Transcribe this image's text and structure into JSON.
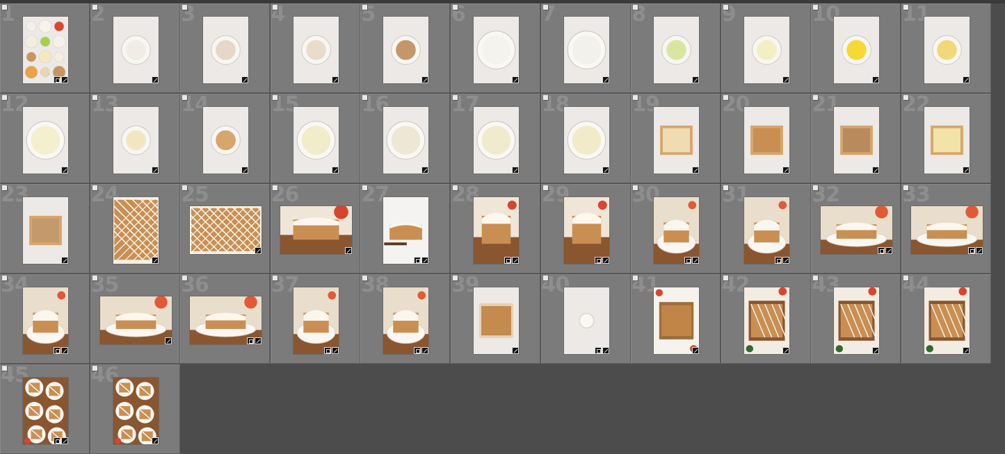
{
  "window": {
    "background": "#4c4c4c",
    "cell_color": "#7b7b7b"
  },
  "badges": {
    "edit_icon": "develop-adjust-icon",
    "collection_icon": "virtual-copy-icon"
  },
  "grid": {
    "cells": [
      {
        "n": "1",
        "o": "p",
        "s": "ing",
        "b": [
          "sq",
          "crop"
        ]
      },
      {
        "n": "2",
        "o": "p",
        "s": "bowl",
        "c": "#f2ede4",
        "b": [
          "crop"
        ]
      },
      {
        "n": "3",
        "o": "p",
        "s": "bowl",
        "c": "#e6d8c8",
        "b": [
          "crop"
        ]
      },
      {
        "n": "4",
        "o": "p",
        "s": "bowl",
        "c": "#e8dccb",
        "b": [
          "crop"
        ]
      },
      {
        "n": "5",
        "o": "p",
        "s": "bowl",
        "c": "#c4966a",
        "b": [
          "crop"
        ]
      },
      {
        "n": "6",
        "o": "p",
        "s": "bigbowl",
        "c": "#f5f3ee",
        "b": [
          "crop"
        ]
      },
      {
        "n": "7",
        "o": "p",
        "s": "bigbowl",
        "c": "#f3f1ec",
        "b": [
          "crop"
        ]
      },
      {
        "n": "8",
        "o": "p",
        "s": "bowl",
        "c": "#d9e6a0",
        "b": [
          "crop"
        ]
      },
      {
        "n": "9",
        "o": "p",
        "s": "bowl",
        "c": "#f4efc2",
        "b": [
          "crop"
        ]
      },
      {
        "n": "10",
        "o": "p",
        "s": "bowl",
        "c": "#f6d933",
        "b": [
          "crop"
        ]
      },
      {
        "n": "11",
        "o": "p",
        "s": "bowl",
        "c": "#f1d97a",
        "b": [
          "crop"
        ]
      },
      {
        "n": "12",
        "o": "p",
        "s": "bigbowl",
        "c": "#f4efcf",
        "b": [
          "crop"
        ]
      },
      {
        "n": "13",
        "o": "p",
        "s": "bowl",
        "c": "#f1e6c0",
        "b": [
          "crop"
        ]
      },
      {
        "n": "14",
        "o": "p",
        "s": "bowl",
        "c": "#d7a66b",
        "b": [
          "crop"
        ]
      },
      {
        "n": "15",
        "o": "p",
        "s": "bigbowl",
        "c": "#f1ecc9",
        "b": [
          "crop"
        ]
      },
      {
        "n": "16",
        "o": "p",
        "s": "bigbowl",
        "c": "#eee7d4",
        "b": [
          "crop"
        ]
      },
      {
        "n": "17",
        "o": "p",
        "s": "bigbowl",
        "c": "#f0ebcc",
        "b": [
          "crop"
        ]
      },
      {
        "n": "18",
        "o": "p",
        "s": "bigbowl",
        "c": "#f2ebc9",
        "b": [
          "crop"
        ]
      },
      {
        "n": "19",
        "o": "p",
        "s": "pan",
        "c": "#efdcb2",
        "b": [
          "crop"
        ]
      },
      {
        "n": "20",
        "o": "p",
        "s": "pan",
        "c": "#c98f52",
        "b": [
          "crop"
        ]
      },
      {
        "n": "21",
        "o": "p",
        "s": "pan",
        "c": "#b88a5e",
        "b": [
          "crop"
        ]
      },
      {
        "n": "22",
        "o": "p",
        "s": "pan",
        "c": "#f2e3a8",
        "b": [
          "crop"
        ]
      },
      {
        "n": "23",
        "o": "p",
        "s": "pan",
        "c": "#c49a6c",
        "b": [
          "crop"
        ]
      },
      {
        "n": "24",
        "o": "p",
        "s": "bars",
        "b": [
          "crop"
        ]
      },
      {
        "n": "25",
        "o": "l",
        "s": "bars",
        "b": [
          "crop"
        ]
      },
      {
        "n": "26",
        "o": "l",
        "s": "slice",
        "b": [
          "crop"
        ]
      },
      {
        "n": "27",
        "o": "p",
        "s": "slicewhite",
        "b": [
          "sq",
          "crop"
        ]
      },
      {
        "n": "28",
        "o": "p",
        "s": "slice",
        "b": [
          "sq",
          "crop"
        ]
      },
      {
        "n": "29",
        "o": "p",
        "s": "slice",
        "b": [
          "sq",
          "crop"
        ]
      },
      {
        "n": "30",
        "o": "p",
        "s": "plate",
        "b": [
          "sq",
          "crop"
        ]
      },
      {
        "n": "31",
        "o": "p",
        "s": "plate",
        "b": [
          "sq",
          "crop"
        ]
      },
      {
        "n": "32",
        "o": "l",
        "s": "plate",
        "b": [
          "sq",
          "crop"
        ]
      },
      {
        "n": "33",
        "o": "l",
        "s": "plate",
        "b": [
          "sq",
          "crop"
        ]
      },
      {
        "n": "34",
        "o": "p",
        "s": "plate",
        "b": [
          "sq",
          "crop"
        ]
      },
      {
        "n": "35",
        "o": "l",
        "s": "plate",
        "b": [
          "crop"
        ]
      },
      {
        "n": "36",
        "o": "l",
        "s": "plate",
        "b": [
          "sq",
          "crop"
        ]
      },
      {
        "n": "37",
        "o": "p",
        "s": "plate",
        "b": [
          "sq",
          "crop"
        ]
      },
      {
        "n": "38",
        "o": "p",
        "s": "plate",
        "b": [
          "sq",
          "crop"
        ]
      },
      {
        "n": "39",
        "o": "p",
        "s": "panplain",
        "c": "#c48a4e",
        "b": [
          "crop"
        ]
      },
      {
        "n": "40",
        "o": "p",
        "s": "cup",
        "b": [
          "sq",
          "crop"
        ]
      },
      {
        "n": "41",
        "o": "p",
        "s": "overhead",
        "c": "#c18547",
        "b": [
          "crop"
        ]
      },
      {
        "n": "42",
        "o": "p",
        "s": "overheadiced",
        "b": [
          "crop"
        ]
      },
      {
        "n": "43",
        "o": "p",
        "s": "overheadiced",
        "b": [
          "crop"
        ]
      },
      {
        "n": "44",
        "o": "p",
        "s": "overheadiced",
        "b": [
          "crop"
        ]
      },
      {
        "n": "45",
        "o": "p",
        "s": "platesover",
        "b": [
          "sq",
          "crop"
        ]
      },
      {
        "n": "46",
        "o": "p",
        "s": "platesover",
        "b": [
          "crop"
        ]
      }
    ]
  }
}
